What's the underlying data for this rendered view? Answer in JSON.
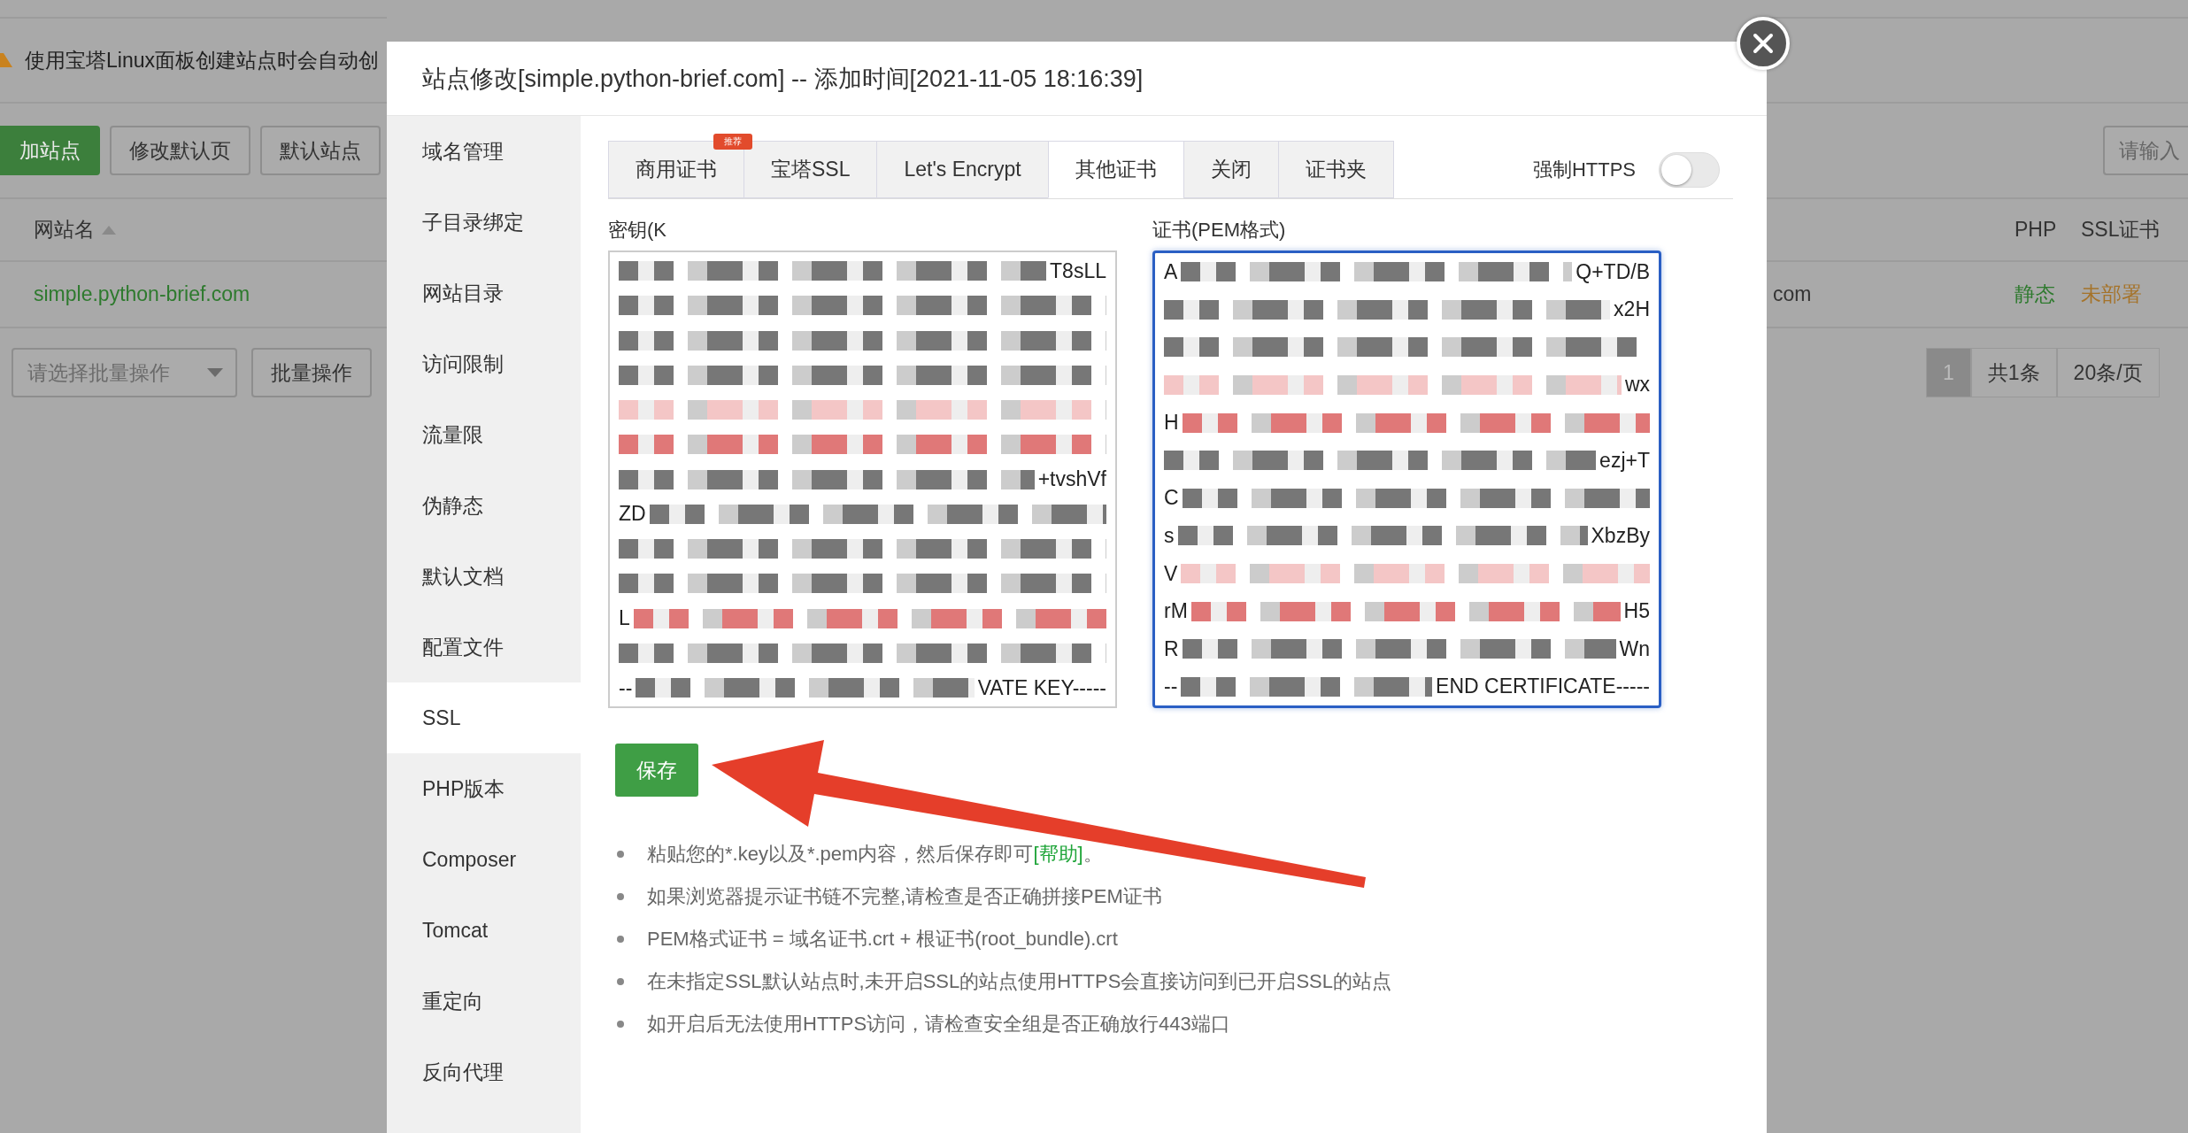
{
  "background": {
    "notice": "使用宝塔Linux面板创建站点时会自动创",
    "toolbar_buttons": [
      {
        "label": "加站点",
        "kind": "primary"
      },
      {
        "label": "修改默认页",
        "kind": "default"
      },
      {
        "label": "默认站点",
        "kind": "default"
      }
    ],
    "search": {
      "placeholder": "请输入"
    },
    "table": {
      "columns": [
        "网站名",
        "PHP",
        "SSL证书"
      ],
      "rows": [
        {
          "site": "simple.python-brief.com",
          "column_2": "com",
          "php": "静态",
          "ssl": "未部署"
        }
      ]
    },
    "batch": {
      "select_placeholder": "请选择批量操作",
      "button": "批量操作"
    },
    "pagination": {
      "pages": [
        {
          "label": "1",
          "selected": true
        }
      ],
      "total": "共1条",
      "page_size": "20条/页"
    }
  },
  "dialog": {
    "title": "站点修改[simple.python-brief.com] -- 添加时间[2021-11-05 18:16:39]",
    "sidebar": [
      {
        "label": "域名管理",
        "selected": false
      },
      {
        "label": "子目录绑定",
        "selected": false
      },
      {
        "label": "网站目录",
        "selected": false
      },
      {
        "label": "访问限制",
        "selected": false
      },
      {
        "label": "流量限",
        "selected": false
      },
      {
        "label": "伪静态",
        "selected": false
      },
      {
        "label": "默认文档",
        "selected": false
      },
      {
        "label": "配置文件",
        "selected": false
      },
      {
        "label": "SSL",
        "selected": true
      },
      {
        "label": "PHP版本",
        "selected": false
      },
      {
        "label": "Composer",
        "selected": false
      },
      {
        "label": "Tomcat",
        "selected": false
      },
      {
        "label": "重定向",
        "selected": false
      },
      {
        "label": "反向代理",
        "selected": false
      }
    ],
    "tabs": [
      {
        "label": "商用证书",
        "selected": false,
        "badge": "推荐"
      },
      {
        "label": "宝塔SSL",
        "selected": false
      },
      {
        "label": "Let's Encrypt",
        "selected": false
      },
      {
        "label": "其他证书",
        "selected": true
      },
      {
        "label": "关闭",
        "selected": false
      },
      {
        "label": "证书夹",
        "selected": false
      }
    ],
    "force_https": {
      "label": "强制HTTPS",
      "on": false
    },
    "key_field": {
      "label": "密钥(K",
      "focused": false,
      "lines": [
        {
          "tail": "T8sLL",
          "color": "#777777"
        },
        {
          "color": "#777777"
        },
        {
          "color": "#777777"
        },
        {
          "color": "#777777"
        },
        {
          "color": "#f4c6c6"
        },
        {
          "color": "#e07878"
        },
        {
          "tail": "+tvshVf",
          "color": "#777777"
        },
        {
          "lead": "ZD",
          "color": "#777777"
        },
        {
          "color": "#777777"
        },
        {
          "color": "#777777"
        },
        {
          "lead": "L",
          "color": "#e07878"
        },
        {
          "color": "#777777"
        },
        {
          "lead": "--",
          "tail": "VATE KEY-----",
          "color": "#777777"
        }
      ]
    },
    "cert_field": {
      "label": "证书(PEM格式)",
      "focused": true,
      "lines": [
        {
          "lead": "A",
          "tail": "Q+TD/B",
          "color": "#777777"
        },
        {
          "tail": "x2H",
          "color": "#777777"
        },
        {
          "color": "#777777"
        },
        {
          "tail": "wx",
          "color": "#f4c6c6"
        },
        {
          "lead": "H",
          "color": "#e07878"
        },
        {
          "tail": "ezj+T",
          "color": "#777777"
        },
        {
          "lead": "C",
          "color": "#777777"
        },
        {
          "lead": "s",
          "tail": "XbzBy",
          "color": "#777777"
        },
        {
          "lead": "V",
          "color": "#f4c6c6"
        },
        {
          "lead": "rM",
          "tail": "H5",
          "color": "#e07878"
        },
        {
          "lead": "R",
          "tail": "Wn",
          "color": "#777777"
        },
        {
          "lead": "--",
          "tail": "END CERTIFICATE-----",
          "color": "#777777"
        }
      ]
    },
    "save_button": "保存",
    "notes": [
      {
        "text": "粘贴您的*.key以及*.pem内容，然后保存即可",
        "link": "[帮助]",
        "after": "。"
      },
      {
        "text": "如果浏览器提示证书链不完整,请检查是否正确拼接PEM证书"
      },
      {
        "text": "PEM格式证书 = 域名证书.crt + 根证书(root_bundle).crt"
      },
      {
        "text": "在未指定SSL默认站点时,未开启SSL的站点使用HTTPS会直接访问到已开启SSL的站点"
      },
      {
        "text": "如开启后无法使用HTTPS访问，请检查安全组是否正确放行443端口"
      }
    ]
  }
}
